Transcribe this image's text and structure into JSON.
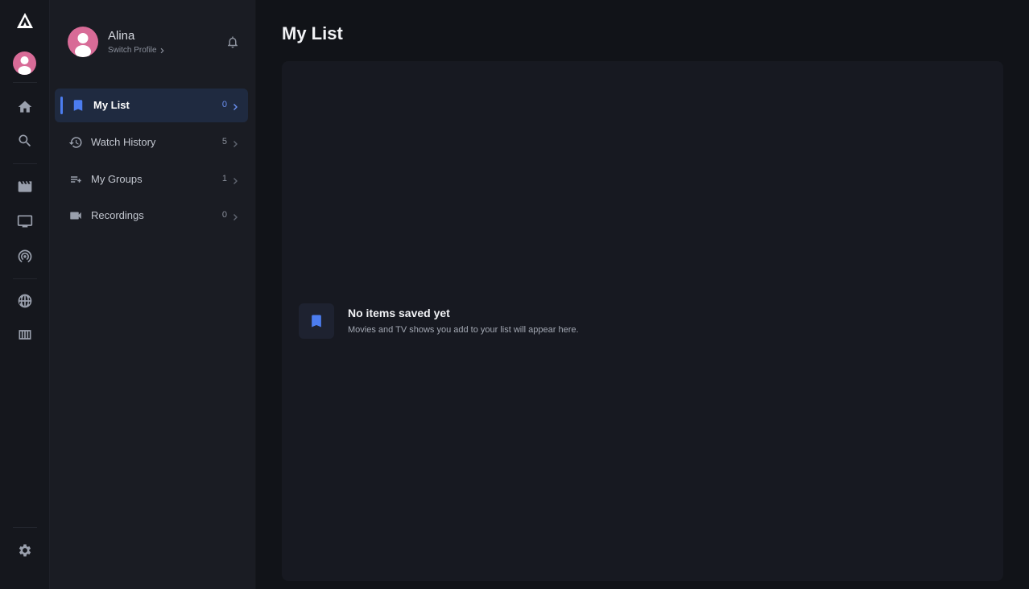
{
  "rail": {
    "items": [
      {
        "name": "home",
        "icon": "home-icon"
      },
      {
        "name": "search",
        "icon": "search-icon"
      },
      {
        "name": "movies",
        "icon": "clapperboard-icon"
      },
      {
        "name": "tv",
        "icon": "tv-icon"
      },
      {
        "name": "live",
        "icon": "broadcast-icon"
      },
      {
        "name": "sports",
        "icon": "basketball-icon"
      },
      {
        "name": "guide",
        "icon": "grid-guide-icon"
      }
    ],
    "settings_icon": "gear-icon"
  },
  "profile": {
    "name": "Alina",
    "switch_label": "Switch Profile",
    "avatar_color": "#d86b97"
  },
  "menu": [
    {
      "label": "My List",
      "count": "0",
      "icon": "bookmark-icon",
      "active": true
    },
    {
      "label": "Watch History",
      "count": "5",
      "icon": "history-icon",
      "active": false
    },
    {
      "label": "My Groups",
      "count": "1",
      "icon": "playlist-icon",
      "active": false
    },
    {
      "label": "Recordings",
      "count": "0",
      "icon": "video-camera-icon",
      "active": false
    }
  ],
  "main": {
    "title": "My List",
    "empty_title": "No items saved yet",
    "empty_subtitle": "Movies and TV shows you add to your list will appear here."
  },
  "colors": {
    "accent": "#4c7df0",
    "background": "#111318",
    "panel": "#1a1c23"
  }
}
